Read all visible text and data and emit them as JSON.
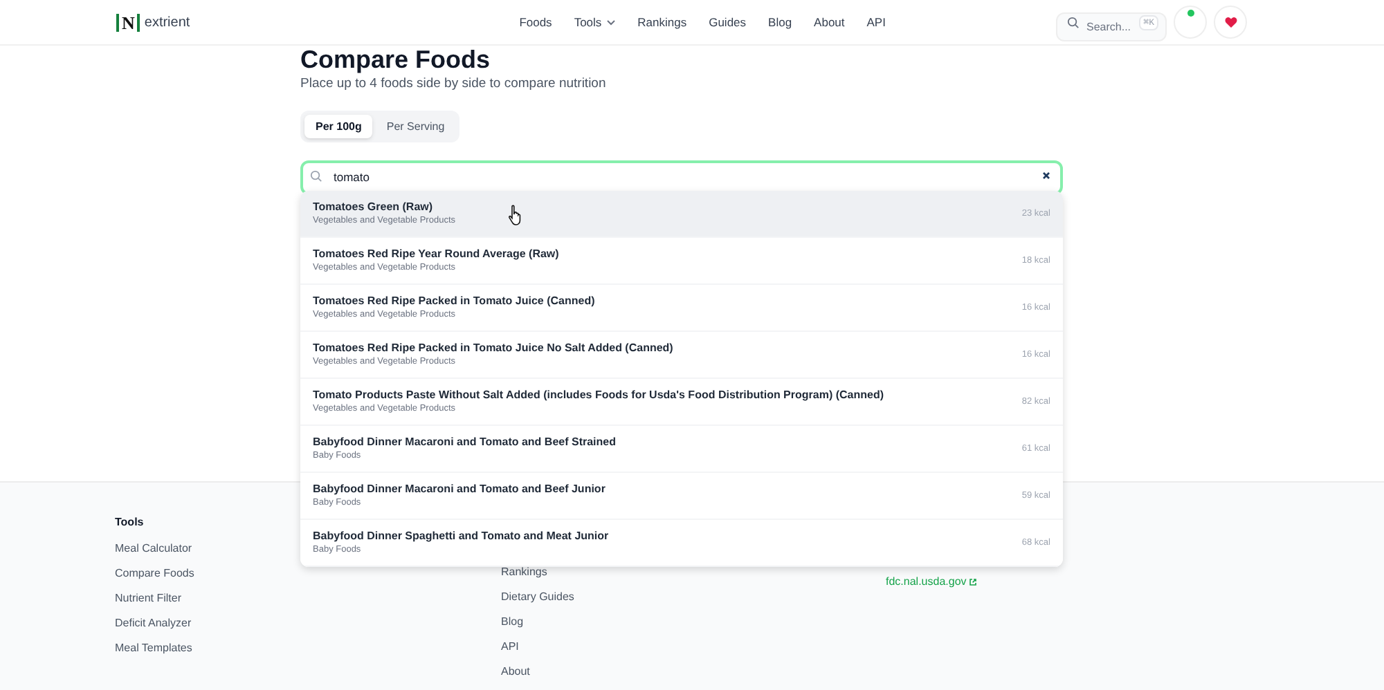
{
  "header": {
    "logo": {
      "mark": "N",
      "text": "extrient"
    },
    "nav": [
      {
        "label": "Foods",
        "dropdown": false
      },
      {
        "label": "Tools",
        "dropdown": true
      },
      {
        "label": "Rankings",
        "dropdown": false
      },
      {
        "label": "Guides",
        "dropdown": false
      },
      {
        "label": "Blog",
        "dropdown": false
      },
      {
        "label": "About",
        "dropdown": false
      },
      {
        "label": "API",
        "dropdown": false
      }
    ],
    "search": {
      "placeholder": "Search...",
      "shortcut": "⌘K"
    }
  },
  "page": {
    "title": "Compare Foods",
    "subtitle": "Place up to 4 foods side by side to compare nutrition",
    "units": [
      {
        "label": "Per 100g",
        "selected": true
      },
      {
        "label": "Per Serving",
        "selected": false
      }
    ],
    "food_search": {
      "value": "tomato"
    },
    "results": [
      {
        "name": "Tomatoes Green (Raw)",
        "category": "Vegetables and Vegetable Products",
        "calories": "23 kcal",
        "highlighted": true
      },
      {
        "name": "Tomatoes Red Ripe Year Round Average (Raw)",
        "category": "Vegetables and Vegetable Products",
        "calories": "18 kcal",
        "highlighted": false
      },
      {
        "name": "Tomatoes Red Ripe Packed in Tomato Juice (Canned)",
        "category": "Vegetables and Vegetable Products",
        "calories": "16 kcal",
        "highlighted": false
      },
      {
        "name": "Tomatoes Red Ripe Packed in Tomato Juice No Salt Added (Canned)",
        "category": "Vegetables and Vegetable Products",
        "calories": "16 kcal",
        "highlighted": false
      },
      {
        "name": "Tomato Products Paste Without Salt Added (includes Foods for Usda's Food Distribution Program) (Canned)",
        "category": "Vegetables and Vegetable Products",
        "calories": "82 kcal",
        "highlighted": false
      },
      {
        "name": "Babyfood Dinner Macaroni and Tomato and Beef Strained",
        "category": "Baby Foods",
        "calories": "61 kcal",
        "highlighted": false
      },
      {
        "name": "Babyfood Dinner Macaroni and Tomato and Beef Junior",
        "category": "Baby Foods",
        "calories": "59 kcal",
        "highlighted": false
      },
      {
        "name": "Babyfood Dinner Spaghetti and Tomato and Meat Junior",
        "category": "Baby Foods",
        "calories": "68 kcal",
        "highlighted": false
      }
    ]
  },
  "footer": {
    "tools": {
      "heading": "Tools",
      "links": [
        "Meal Calculator",
        "Compare Foods",
        "Nutrient Filter",
        "Deficit Analyzer",
        "Meal Templates"
      ]
    },
    "explore": {
      "links": [
        "Rankings",
        "Dietary Guides",
        "Blog",
        "API",
        "About"
      ]
    },
    "source": {
      "link": "fdc.nal.usda.gov"
    }
  }
}
